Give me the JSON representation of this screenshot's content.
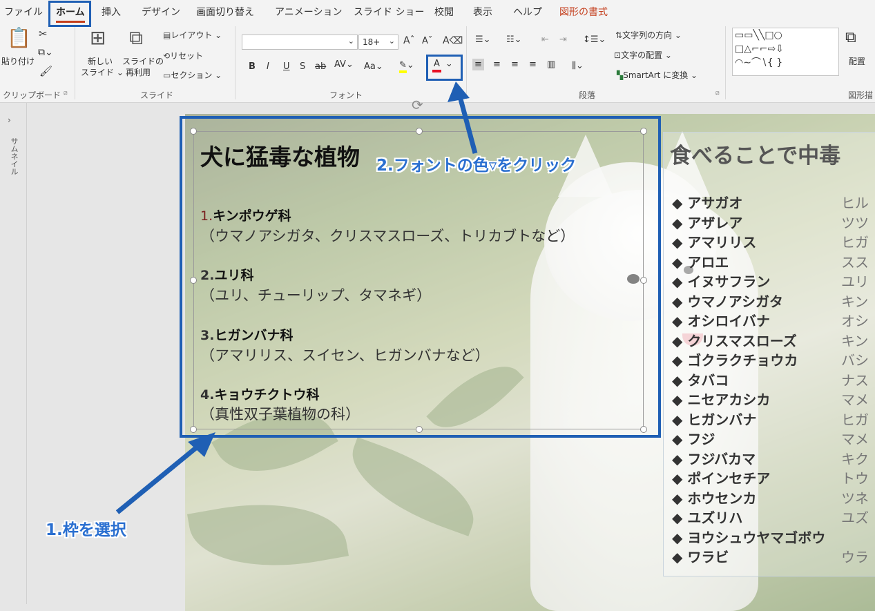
{
  "menu": {
    "items": [
      "ファイル",
      "ホーム",
      "挿入",
      "デザイン",
      "画面切り替え",
      "アニメーション",
      "スライド ショー",
      "校閲",
      "表示",
      "ヘルプ",
      "図形の書式"
    ],
    "active": "ホーム"
  },
  "ribbon": {
    "clipboard": {
      "paste_label": "貼り付け",
      "group_label": "クリップボード"
    },
    "slides": {
      "new_slide_line1": "新しい",
      "new_slide_line2": "スライド ⌄",
      "reuse_line1": "スライドの",
      "reuse_line2": "再利用",
      "layout": "レイアウト ⌄",
      "reset": "リセット",
      "section": "セクション ⌄",
      "group_label": "スライド"
    },
    "font": {
      "font_name": "",
      "font_size": "18+",
      "bold": "B",
      "italic": "I",
      "underline": "U",
      "shadow": "S",
      "strike": "ab",
      "spacing": "AV",
      "case": "Aa",
      "font_color": "A",
      "font_color_value": "#e81123",
      "highlight_color_value": "#ffff00",
      "group_label": "フォント"
    },
    "paragraph": {
      "text_direction": "文字列の方向 ⌄",
      "align_text": "文字の配置 ⌄",
      "smartart": "SmartArt に変換 ⌄",
      "group_label": "段落"
    },
    "drawing": {
      "arrange_label": "配置",
      "group_label": "図形描"
    }
  },
  "leftpane": {
    "label": "サムネイル"
  },
  "slide": {
    "title": "犬に猛毒な植物",
    "families": [
      {
        "num": "1.",
        "name": "キンポウゲ科",
        "detail": "（ウマノアシガタ、クリスマスローズ、トリカブトなど）"
      },
      {
        "num": "2.",
        "name": "ユリ科",
        "detail": "（ユリ、チューリップ、タマネギ）"
      },
      {
        "num": "3.",
        "name": "ヒガンバナ科",
        "detail": "（アマリリス、スイセン、ヒガンバナなど）"
      },
      {
        "num": "4.",
        "name": "キョウチクトウ科",
        "detail": "（真性双子葉植物の科）"
      }
    ],
    "right_title": "食べることで中毒",
    "plants": [
      {
        "name": "◆ アサガオ",
        "family": "ヒル"
      },
      {
        "name": "◆ アザレア",
        "family": "ツツ"
      },
      {
        "name": "◆ アマリリス",
        "family": "ヒガ"
      },
      {
        "name": "◆ アロエ",
        "family": "スス"
      },
      {
        "name": "◆ イヌサフラン",
        "family": "ユリ"
      },
      {
        "name": "◆ ウマノアシガタ",
        "family": "キン"
      },
      {
        "name": "◆ オシロイバナ",
        "family": "オシ"
      },
      {
        "name": "◆ クリスマスローズ",
        "family": "キン"
      },
      {
        "name": "◆ ゴクラクチョウカ",
        "family": "バシ"
      },
      {
        "name": "◆ タバコ",
        "family": "ナス"
      },
      {
        "name": "◆ ニセアカシカ",
        "family": "マメ"
      },
      {
        "name": "◆ ヒガンバナ",
        "family": "ヒガ"
      },
      {
        "name": "◆ フジ",
        "family": "マメ"
      },
      {
        "name": "◆ フジバカマ",
        "family": "キク"
      },
      {
        "name": "◆ ポインセチア",
        "family": "トウ"
      },
      {
        "name": "◆ ホウセンカ",
        "family": "ツネ"
      },
      {
        "name": "◆ ユズリハ",
        "family": "ユズ"
      },
      {
        "name": "◆ ヨウシュウヤマゴボウ",
        "family": ""
      },
      {
        "name": "◆ ワラビ",
        "family": "ウラ"
      }
    ]
  },
  "annotations": {
    "step1": "1.枠を選択",
    "step2": "2.フォントの色▿をクリック",
    "accent_color": "#1f5fb4"
  }
}
